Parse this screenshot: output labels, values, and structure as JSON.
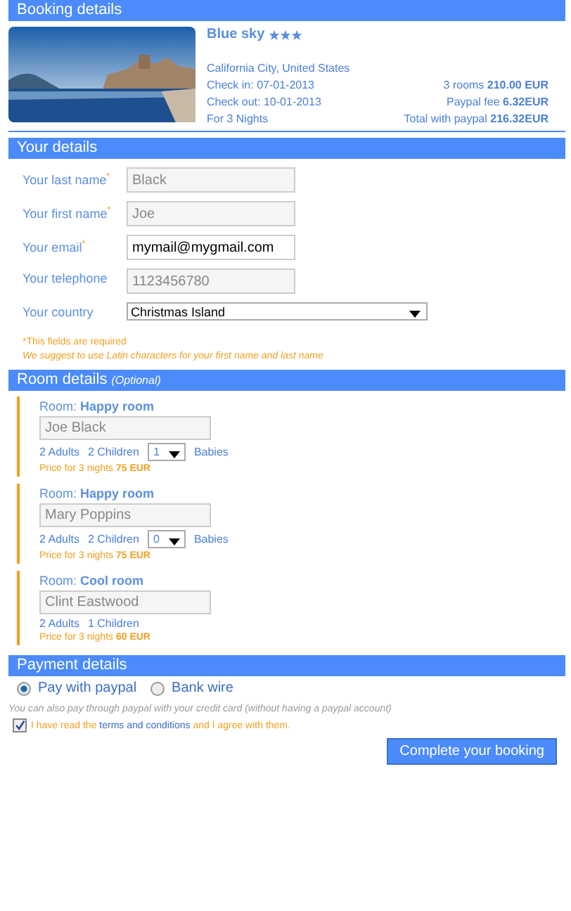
{
  "booking": {
    "header": "Booking details",
    "hotel": "Blue sky",
    "stars": 3,
    "location": "California City, United States",
    "check_in": "Check in: 07-01-2013",
    "check_out": "Check out: 10-01-2013",
    "nights": "For 3 Nights",
    "prices": [
      "3 rooms **210.00 EUR**",
      "Paypal fee **6.32EUR**",
      "Total with paypal **216.32EUR**"
    ]
  },
  "details": {
    "header": "Your details",
    "fields": [
      {
        "kind": "text",
        "label": "Your last name$^{*}$",
        "placeholder": "Black"
      },
      {
        "kind": "text",
        "label": "Your first name$^{*}$",
        "placeholder": "Joe"
      },
      {
        "kind": "text",
        "label": "Your email$^{*}$",
        "value": "mymail@mygmail.com"
      },
      {
        "kind": "text",
        "label": "Your telephone",
        "placeholder": "1123456780"
      },
      {
        "kind": "select",
        "label": "Your country",
        "value": "Christmas Island"
      }
    ],
    "required_note": "*This fields are required",
    "latin_note": "We suggest to use Latin characters for your first name and last name"
  },
  "rooms": {
    "header": "Room details",
    "header_note": "(Optional)",
    "items": [
      {
        "prefix": "Room:",
        "name": "Happy room",
        "guest_placeholder": "Joe Black",
        "adults": "2 Adults",
        "children": "2 Children",
        "babies_value": "1",
        "babies_label": "Babies",
        "price": "Price for 3 nights **75 EUR**"
      },
      {
        "prefix": "Room:",
        "name": "Happy room",
        "guest_placeholder": "Mary Poppins",
        "adults": "2 Adults",
        "children": "2 Children",
        "babies_value": "0",
        "babies_label": "Babies",
        "price": "Price for 3 nights **75 EUR**"
      },
      {
        "prefix": "Room:",
        "name": "Cool room",
        "guest_placeholder": "Clint Eastwood",
        "adults": "2 Adults",
        "children": "1 Children",
        "price": "Price for 3 nights **60 EUR**"
      }
    ]
  },
  "payment": {
    "header": "Payment details",
    "options": [
      {
        "label": "Pay with paypal",
        "selected": true
      },
      {
        "label": "Bank wire",
        "selected": false
      }
    ],
    "hint": "You can also pay through paypal with your credit card (without having a paypal account)",
    "terms": {
      "checked": true,
      "before": "I have read the",
      "link": "terms and conditions",
      "after": "and I agree with them."
    },
    "submit": "Complete your booking"
  }
}
